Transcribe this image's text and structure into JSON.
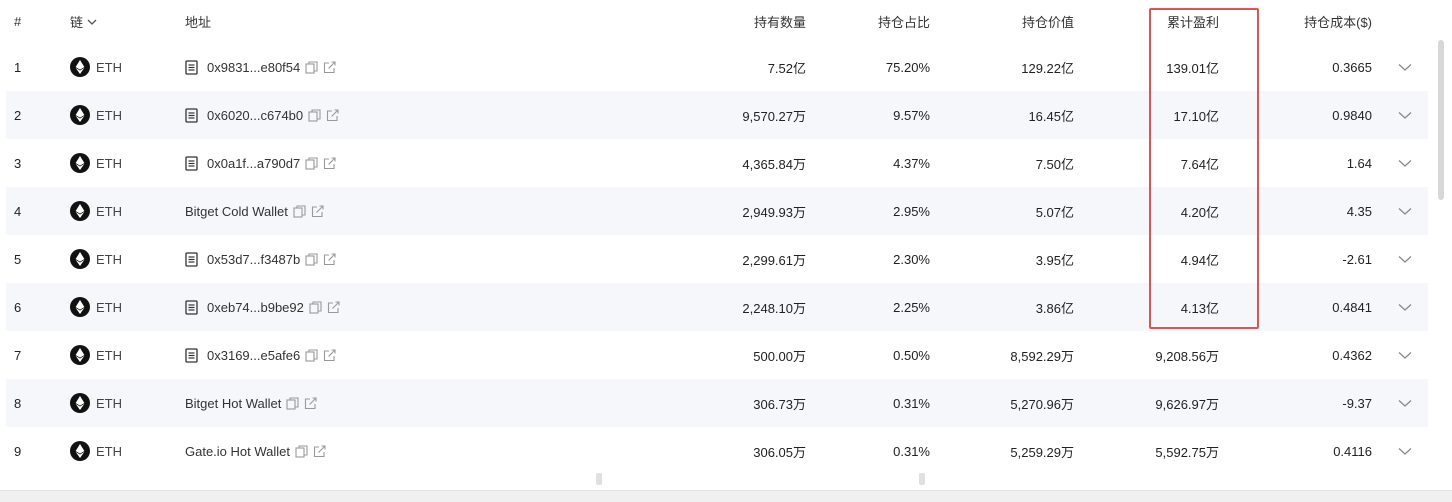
{
  "header": {
    "num": "#",
    "chain": "链",
    "address": "地址",
    "quantity": "持有数量",
    "share": "持仓占比",
    "value": "持仓价值",
    "pnl": "累计盈利",
    "cost": "持仓成本($)"
  },
  "icons": {
    "chain": "ethereum-icon",
    "address": "document-icon",
    "copy": "copy-icon",
    "link": "external-link-icon",
    "expand": "chevron-down-icon"
  },
  "colors": {
    "highlight_border": "#e25252",
    "row_alt": "#f5f7fa"
  },
  "rows": [
    {
      "num": "1",
      "chain": "ETH",
      "address": "0x9831...e80f54",
      "has_doc": true,
      "quantity": "7.52亿",
      "share": "75.20%",
      "value": "129.22亿",
      "pnl": "139.01亿",
      "cost": "0.3665"
    },
    {
      "num": "2",
      "chain": "ETH",
      "address": "0x6020...c674b0",
      "has_doc": true,
      "quantity": "9,570.27万",
      "share": "9.57%",
      "value": "16.45亿",
      "pnl": "17.10亿",
      "cost": "0.9840"
    },
    {
      "num": "3",
      "chain": "ETH",
      "address": "0x0a1f...a790d7",
      "has_doc": true,
      "quantity": "4,365.84万",
      "share": "4.37%",
      "value": "7.50亿",
      "pnl": "7.64亿",
      "cost": "1.64"
    },
    {
      "num": "4",
      "chain": "ETH",
      "address": "Bitget Cold Wallet",
      "has_doc": false,
      "quantity": "2,949.93万",
      "share": "2.95%",
      "value": "5.07亿",
      "pnl": "4.20亿",
      "cost": "4.35"
    },
    {
      "num": "5",
      "chain": "ETH",
      "address": "0x53d7...f3487b",
      "has_doc": true,
      "quantity": "2,299.61万",
      "share": "2.30%",
      "value": "3.95亿",
      "pnl": "4.94亿",
      "cost": "-2.61"
    },
    {
      "num": "6",
      "chain": "ETH",
      "address": "0xeb74...b9be92",
      "has_doc": true,
      "quantity": "2,248.10万",
      "share": "2.25%",
      "value": "3.86亿",
      "pnl": "4.13亿",
      "cost": "0.4841"
    },
    {
      "num": "7",
      "chain": "ETH",
      "address": "0x3169...e5afe6",
      "has_doc": true,
      "quantity": "500.00万",
      "share": "0.50%",
      "value": "8,592.29万",
      "pnl": "9,208.56万",
      "cost": "0.4362"
    },
    {
      "num": "8",
      "chain": "ETH",
      "address": "Bitget Hot Wallet",
      "has_doc": false,
      "quantity": "306.73万",
      "share": "0.31%",
      "value": "5,270.96万",
      "pnl": "9,626.97万",
      "cost": "-9.37"
    },
    {
      "num": "9",
      "chain": "ETH",
      "address": "Gate.io Hot Wallet",
      "has_doc": false,
      "quantity": "306.05万",
      "share": "0.31%",
      "value": "5,259.29万",
      "pnl": "5,592.75万",
      "cost": "0.4116"
    }
  ]
}
